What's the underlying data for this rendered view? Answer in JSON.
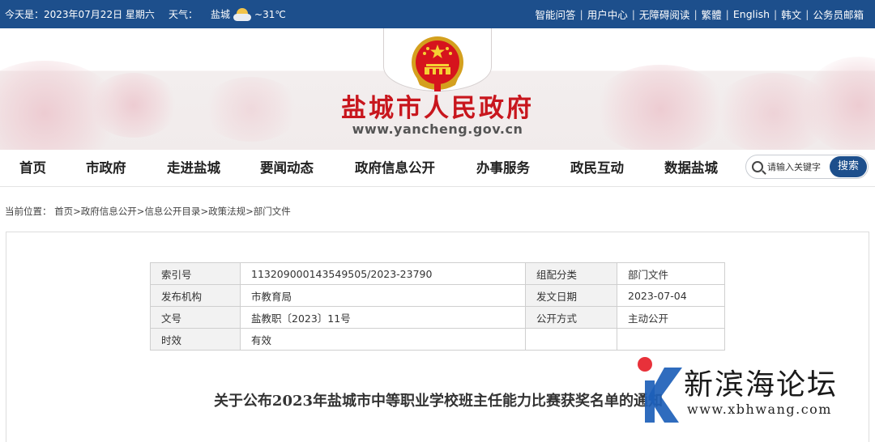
{
  "topbar": {
    "date_label": "今天是：2023年07月22日 星期六",
    "weather_label": "天气：",
    "city": "盐城",
    "temperature": "~31℃",
    "links": [
      "智能问答",
      "用户中心",
      "无障碍阅读",
      "繁體",
      "English",
      "韩文",
      "公务员邮箱"
    ],
    "bar_color": "#1d4f8c"
  },
  "header": {
    "title": "盐城市人民政府",
    "url": "www.yancheng.gov.cn",
    "title_color": "#c8161d"
  },
  "nav": {
    "items": [
      "首页",
      "市政府",
      "走进盐城",
      "要闻动态",
      "政府信息公开",
      "办事服务",
      "政民互动",
      "数据盐城"
    ]
  },
  "search": {
    "placeholder": "请输入关键字",
    "button_label": "搜索"
  },
  "breadcrumb": {
    "prefix": "当前位置：",
    "items": [
      "首页",
      "政府信息公开",
      "信息公开目录",
      "政策法规",
      "部门文件"
    ],
    "separator": ">"
  },
  "meta_table": {
    "rows": [
      {
        "k1": "索引号",
        "v1": "113209000143549505/2023-23790",
        "k2": "组配分类",
        "v2": "部门文件"
      },
      {
        "k1": "发布机构",
        "v1": "市教育局",
        "k2": "发文日期",
        "v2": "2023-07-04"
      },
      {
        "k1": "文号",
        "v1": "盐教职〔2023〕11号",
        "k2": "公开方式",
        "v2": "主动公开"
      },
      {
        "k1": "时效",
        "v1": "有效",
        "k2": "",
        "v2": ""
      }
    ]
  },
  "document": {
    "title": "关于公布2023年盐城市中等职业学校班主任能力比赛获奖名单的通知"
  },
  "watermark": {
    "name": "新滨海论坛",
    "url": "www.xbhwang.com"
  }
}
